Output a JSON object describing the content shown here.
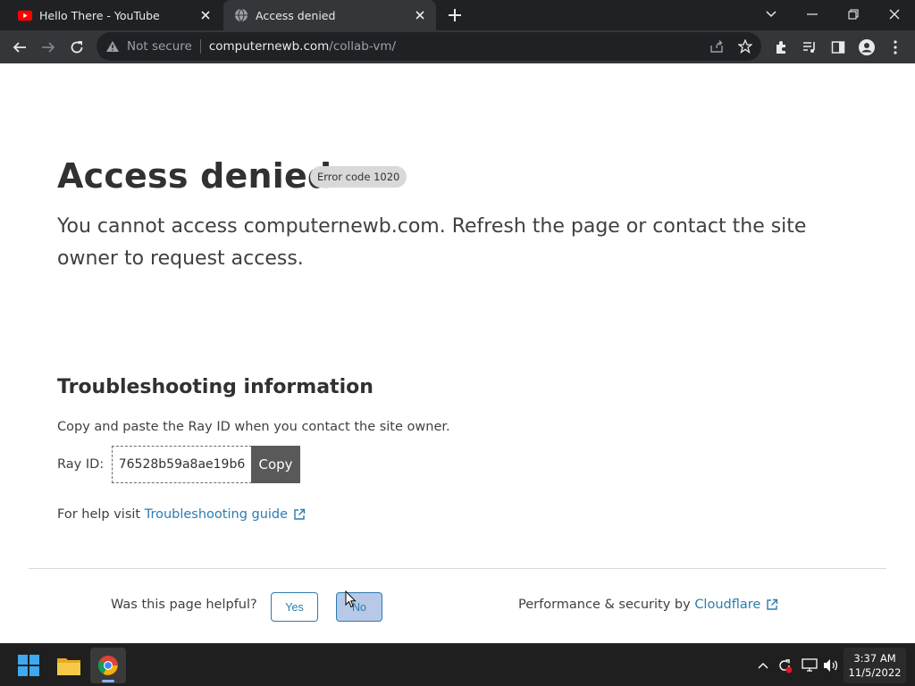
{
  "browser": {
    "tabs": [
      {
        "title": "Hello There - YouTube",
        "favicon": "youtube-icon",
        "active": false
      },
      {
        "title": "Access denied",
        "favicon": "globe-icon",
        "active": true
      }
    ],
    "omnibox": {
      "security_label": "Not secure",
      "host": "computernewb.com",
      "path": "/collab-vm/"
    }
  },
  "page": {
    "title": "Access denied",
    "error_badge": "Error code 1020",
    "message": "You cannot access computernewb.com. Refresh the page or contact the site owner to request access.",
    "troubleshooting": {
      "heading": "Troubleshooting information",
      "instruction": "Copy and paste the Ray ID when you contact the site owner.",
      "ray_label": "Ray ID:",
      "ray_id": "76528b59a8ae19b6",
      "copy_label": "Copy",
      "help_prefix": "For help visit",
      "help_link": "Troubleshooting guide"
    },
    "footer": {
      "helpful_question": "Was this page helpful?",
      "yes_label": "Yes",
      "no_label": "No",
      "perf_prefix": "Performance & security by",
      "perf_link": "Cloudflare"
    }
  },
  "taskbar": {
    "apps": [
      "windows-start-icon",
      "file-explorer-icon",
      "chrome-icon"
    ],
    "time": "3:37 AM",
    "date": "11/5/2022"
  },
  "colors": {
    "link": "#2c7cb0",
    "chrome_dark": "#202124",
    "chrome_toolbar": "#35363a"
  }
}
